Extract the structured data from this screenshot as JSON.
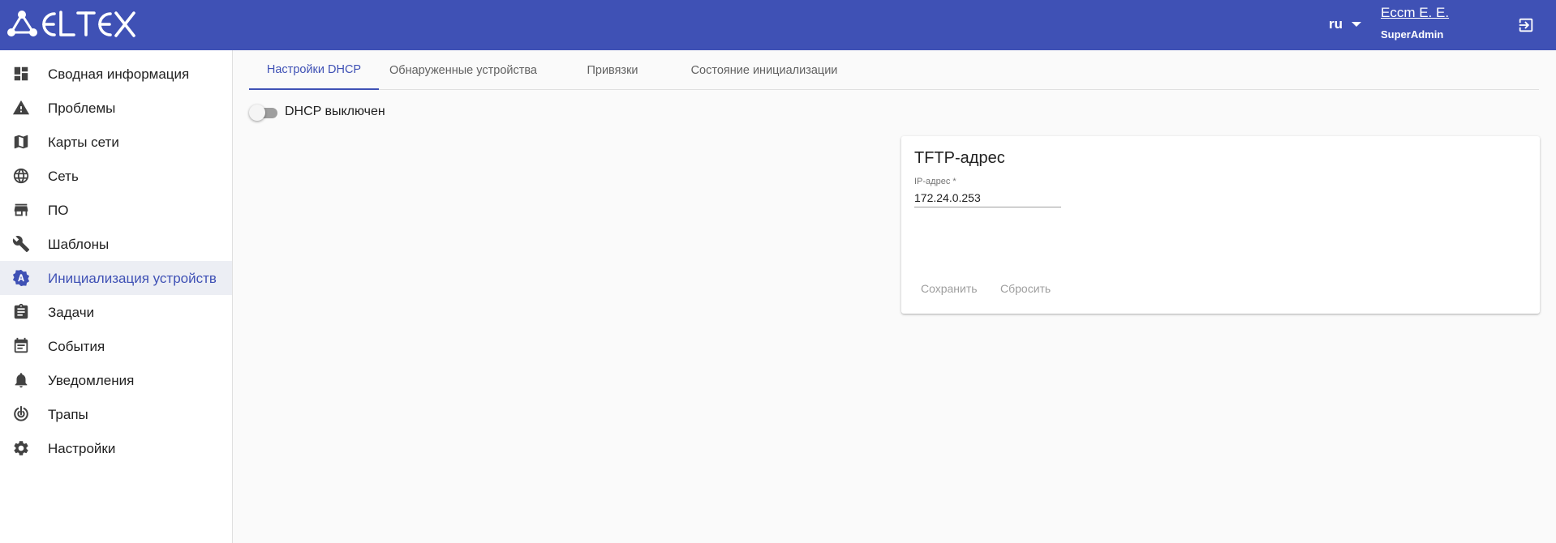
{
  "app": {
    "brand_color": "#3f51b5",
    "language": "ru",
    "user_name": "Eccm E. E.",
    "user_role": "SuperAdmin"
  },
  "sidebar": {
    "items": [
      {
        "label": "Сводная информация",
        "icon": "dashboard-icon"
      },
      {
        "label": "Проблемы",
        "icon": "warning-icon"
      },
      {
        "label": "Карты сети",
        "icon": "map-icon"
      },
      {
        "label": "Сеть",
        "icon": "globe-icon"
      },
      {
        "label": "ПО",
        "icon": "store-icon"
      },
      {
        "label": "Шаблоны",
        "icon": "wrench-icon"
      },
      {
        "label": "Инициализация устройств",
        "icon": "auto-init-icon",
        "active": true
      },
      {
        "label": "Задачи",
        "icon": "clipboard-icon"
      },
      {
        "label": "События",
        "icon": "calendar-icon"
      },
      {
        "label": "Уведомления",
        "icon": "bell-icon"
      },
      {
        "label": "Трапы",
        "icon": "trap-icon"
      },
      {
        "label": "Настройки",
        "icon": "gear-icon"
      }
    ]
  },
  "tabs": [
    {
      "label": "Настройки DHCP",
      "active": true
    },
    {
      "label": "Обнаруженные устройства"
    },
    {
      "label": "Привязки"
    },
    {
      "label": "Состояние инициализации"
    }
  ],
  "dhcp": {
    "toggle_label": "DHCP выключен",
    "enabled": false
  },
  "tftp_card": {
    "title": "TFTP-адрес",
    "field_label": "IP-адрес *",
    "field_value": "172.24.0.253",
    "save_label": "Сохранить",
    "reset_label": "Сбросить"
  }
}
